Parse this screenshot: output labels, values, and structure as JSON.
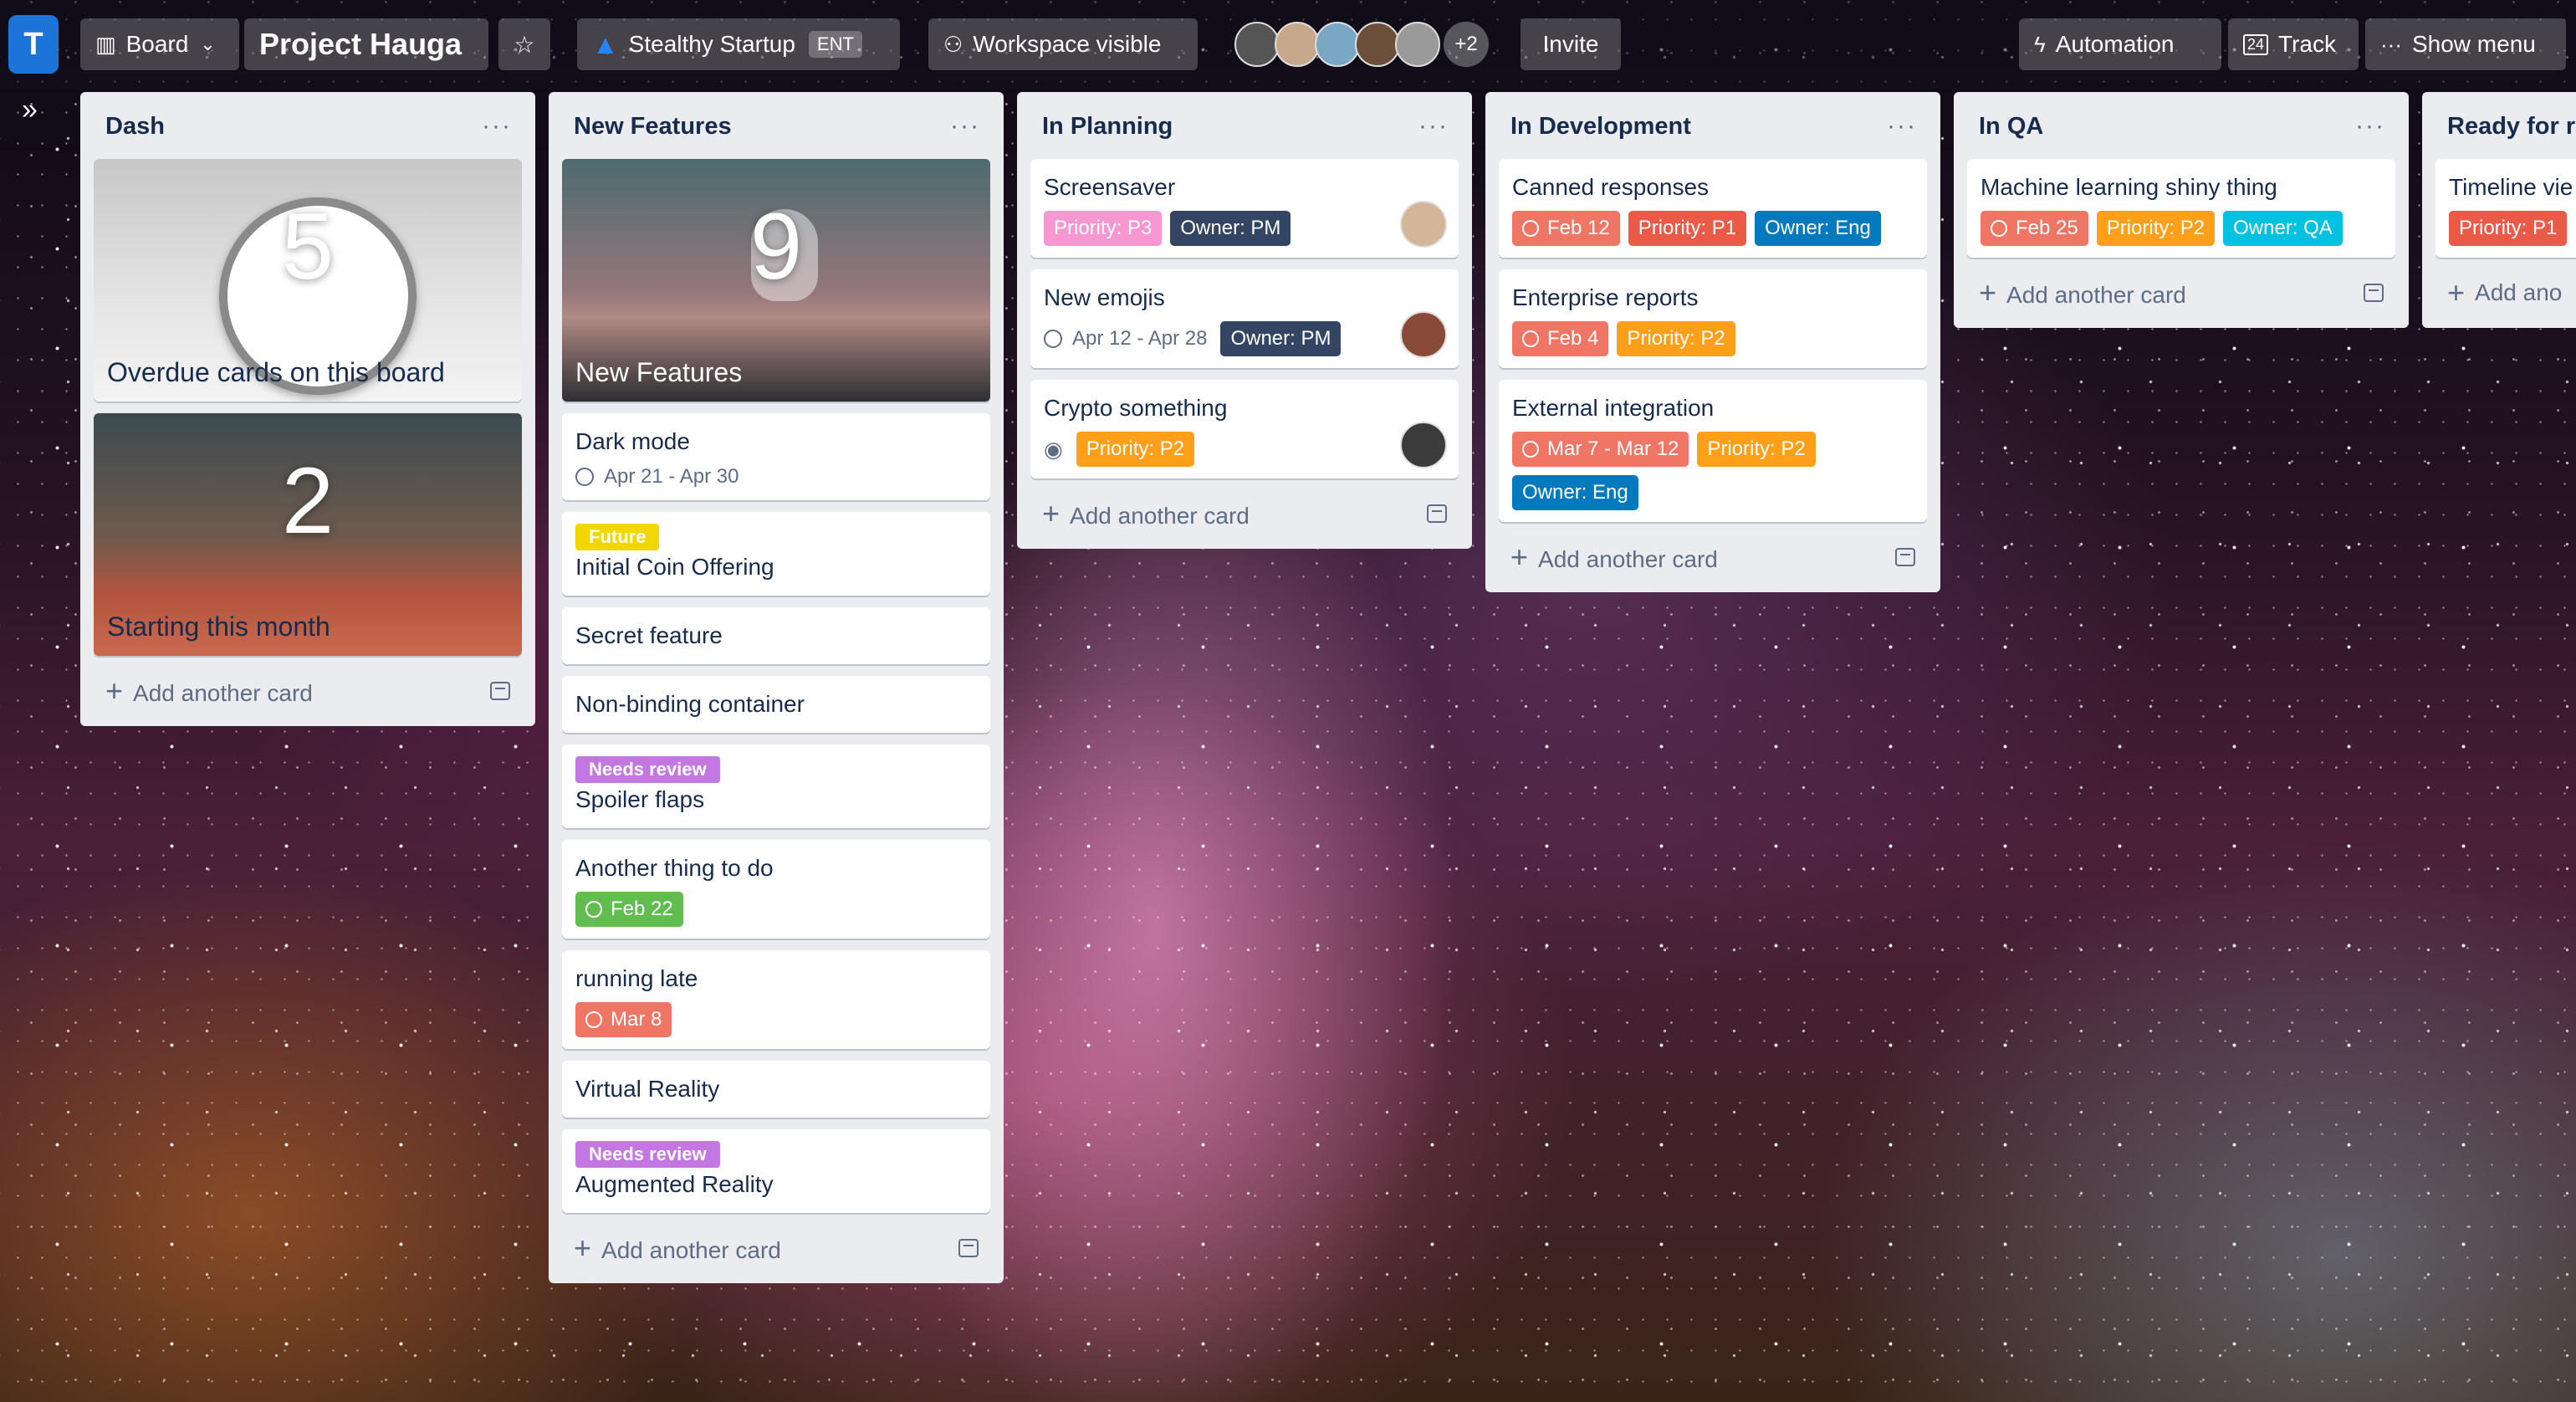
{
  "header": {
    "board_view": "Board",
    "board_name": "Project Hauga",
    "workspace": "Stealthy Startup",
    "workspace_badge": "ENT",
    "visibility": "Workspace visible",
    "members_more": "+2",
    "invite": "Invite",
    "automation": "Automation",
    "track": "Track",
    "show_menu": "Show menu",
    "logo_letter": "T"
  },
  "colors": {
    "pink": "#f797d2",
    "dark": "#344563",
    "red": "#eb5a46",
    "red_light": "#ef7564",
    "orange": "#ff9f1a",
    "blue": "#0079bf",
    "sky": "#00c2e0",
    "green": "#61bd4f",
    "yellow": "#f2d600",
    "purple": "#c377e0"
  },
  "add_card": "Add another card",
  "lists": {
    "dash": {
      "title": "Dash",
      "covers": [
        {
          "number": "5",
          "title": "Overdue cards on this board"
        },
        {
          "number": "2",
          "title": "Starting this month"
        }
      ]
    },
    "new_features": {
      "title": "New Features",
      "cover": {
        "number": "9",
        "title": "New Features"
      },
      "cards": [
        {
          "title": "Dark mode",
          "dates": "Apr 21 - Apr 30"
        },
        {
          "top_label": "Future",
          "title": "Initial Coin Offering"
        },
        {
          "title": "Secret feature"
        },
        {
          "title": "Non-binding container"
        },
        {
          "top_label": "Needs review",
          "title": "Spoiler flaps"
        },
        {
          "title": "Another thing to do",
          "due": "Feb 22"
        },
        {
          "title": "running late",
          "due": "Mar 8"
        },
        {
          "title": "Virtual Reality"
        },
        {
          "top_label": "Needs review",
          "title": "Augmented Reality"
        }
      ]
    },
    "in_planning": {
      "title": "In Planning",
      "cards": [
        {
          "title": "Screensaver",
          "labels": [
            "Priority: P3",
            "Owner: PM"
          ]
        },
        {
          "title": "New emojis",
          "dates": "Apr 12 - Apr 28",
          "labels": [
            "Owner: PM"
          ]
        },
        {
          "title": "Crypto something",
          "labels": [
            "Priority: P2"
          ]
        }
      ]
    },
    "in_development": {
      "title": "In Development",
      "cards": [
        {
          "title": "Canned responses",
          "due": "Feb 12",
          "labels": [
            "Priority: P1",
            "Owner: Eng"
          ]
        },
        {
          "title": "Enterprise reports",
          "due": "Feb 4",
          "labels": [
            "Priority: P2"
          ]
        },
        {
          "title": "External integration",
          "due": "Mar 7 - Mar 12",
          "labels": [
            "Priority: P2",
            "Owner: Eng"
          ]
        }
      ]
    },
    "in_qa": {
      "title": "In QA",
      "cards": [
        {
          "title": "Machine learning shiny thing",
          "due": "Feb 25",
          "labels": [
            "Priority: P2",
            "Owner: QA"
          ]
        }
      ]
    },
    "ready": {
      "title": "Ready for r",
      "cards": [
        {
          "title": "Timeline vie",
          "labels": [
            "Priority: P1"
          ]
        }
      ],
      "add": "Add ano"
    }
  }
}
